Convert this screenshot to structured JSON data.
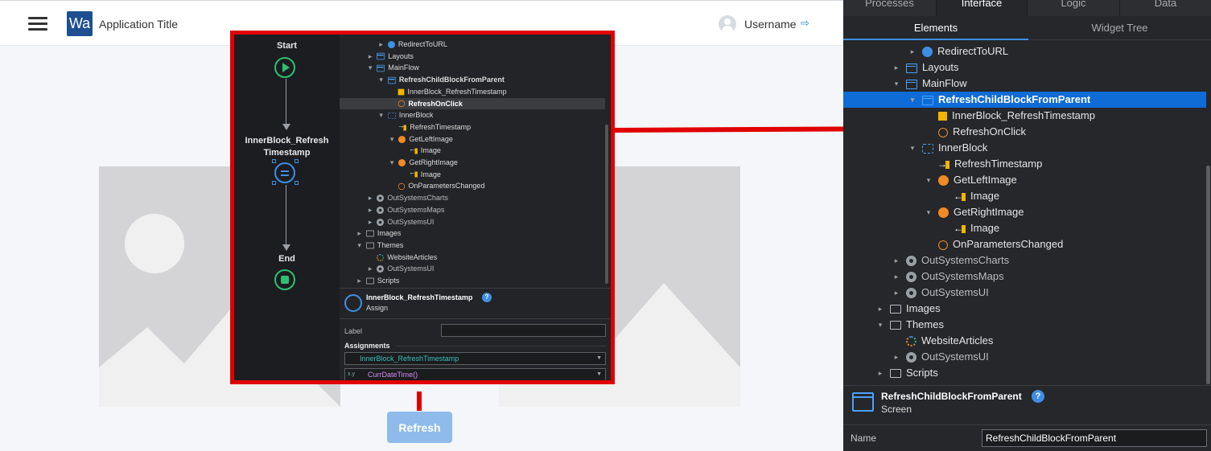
{
  "app": {
    "logo_text": "Wa",
    "title": "Application Title",
    "username": "Username",
    "refresh_label": "Refresh",
    "logout_icon": "logout-icon"
  },
  "zoom": {
    "flow": {
      "start": "Start",
      "assign_line1": "InnerBlock_Refresh",
      "assign_line2": "Timestamp",
      "end": "End"
    },
    "tree": [
      {
        "label": "RedirectToURL",
        "icon": "globe-icon"
      },
      {
        "label": "Layouts",
        "icon": "layouts-icon"
      },
      {
        "label": "MainFlow",
        "icon": "flow-icon"
      },
      {
        "label": "RefreshChildBlockFromParent",
        "icon": "screen-icon"
      },
      {
        "label": "InnerBlock_RefreshTimestamp",
        "icon": "variable-icon"
      },
      {
        "label": "RefreshOnClick",
        "icon": "event-icon"
      },
      {
        "label": "InnerBlock",
        "icon": "block-icon"
      },
      {
        "label": "RefreshTimestamp",
        "icon": "input-parameter-icon"
      },
      {
        "label": "GetLeftImage",
        "icon": "aggregate-icon"
      },
      {
        "label": "Image",
        "icon": "output-icon"
      },
      {
        "label": "GetRightImage",
        "icon": "aggregate-icon"
      },
      {
        "label": "Image",
        "icon": "output-icon"
      },
      {
        "label": "OnParametersChanged",
        "icon": "event-icon"
      },
      {
        "label": "OutSystemsCharts",
        "icon": "module-icon"
      },
      {
        "label": "OutSystemsMaps",
        "icon": "module-icon"
      },
      {
        "label": "OutSystemsUI",
        "icon": "module-icon"
      },
      {
        "label": "Images",
        "icon": "folder-icon"
      },
      {
        "label": "Themes",
        "icon": "folder-icon"
      },
      {
        "label": "WebsiteArticles",
        "icon": "theme-icon"
      },
      {
        "label": "OutSystemsUI",
        "icon": "module-icon"
      },
      {
        "label": "Scripts",
        "icon": "folder-icon"
      }
    ],
    "props": {
      "title": "InnerBlock_RefreshTimestamp",
      "type": "Assign",
      "label_field": "Label",
      "assignments_header": "Assignments",
      "assignment_target": "InnerBlock_RefreshTimestamp",
      "assignment_value": "CurrDateTime()",
      "value_prefix": "x.y"
    }
  },
  "ide": {
    "tabs": [
      "Processes",
      "Interface",
      "Logic",
      "Data"
    ],
    "active_tab": "Interface",
    "subtabs": [
      "Elements",
      "Widget Tree"
    ],
    "tree": [
      {
        "label": "RedirectToURL"
      },
      {
        "label": "Layouts"
      },
      {
        "label": "MainFlow"
      },
      {
        "label": "RefreshChildBlockFromParent"
      },
      {
        "label": "InnerBlock_RefreshTimestamp"
      },
      {
        "label": "RefreshOnClick"
      },
      {
        "label": "InnerBlock"
      },
      {
        "label": "RefreshTimestamp"
      },
      {
        "label": "GetLeftImage"
      },
      {
        "label": "Image"
      },
      {
        "label": "GetRightImage"
      },
      {
        "label": "Image"
      },
      {
        "label": "OnParametersChanged"
      },
      {
        "label": "OutSystemsCharts"
      },
      {
        "label": "OutSystemsMaps"
      },
      {
        "label": "OutSystemsUI"
      },
      {
        "label": "Images"
      },
      {
        "label": "Themes"
      },
      {
        "label": "WebsiteArticles"
      },
      {
        "label": "OutSystemsUI"
      },
      {
        "label": "Scripts"
      }
    ],
    "props": {
      "title": "RefreshChildBlockFromParent",
      "type": "Screen",
      "name_label": "Name",
      "name_value": "RefreshChildBlockFromParent"
    }
  },
  "colors": {
    "accent": "#3f8ee6",
    "selection": "#0f6bd6",
    "highlight_red": "#e00000",
    "logo_bg": "#1d4f91",
    "refresh_button": "#8fbbea"
  }
}
